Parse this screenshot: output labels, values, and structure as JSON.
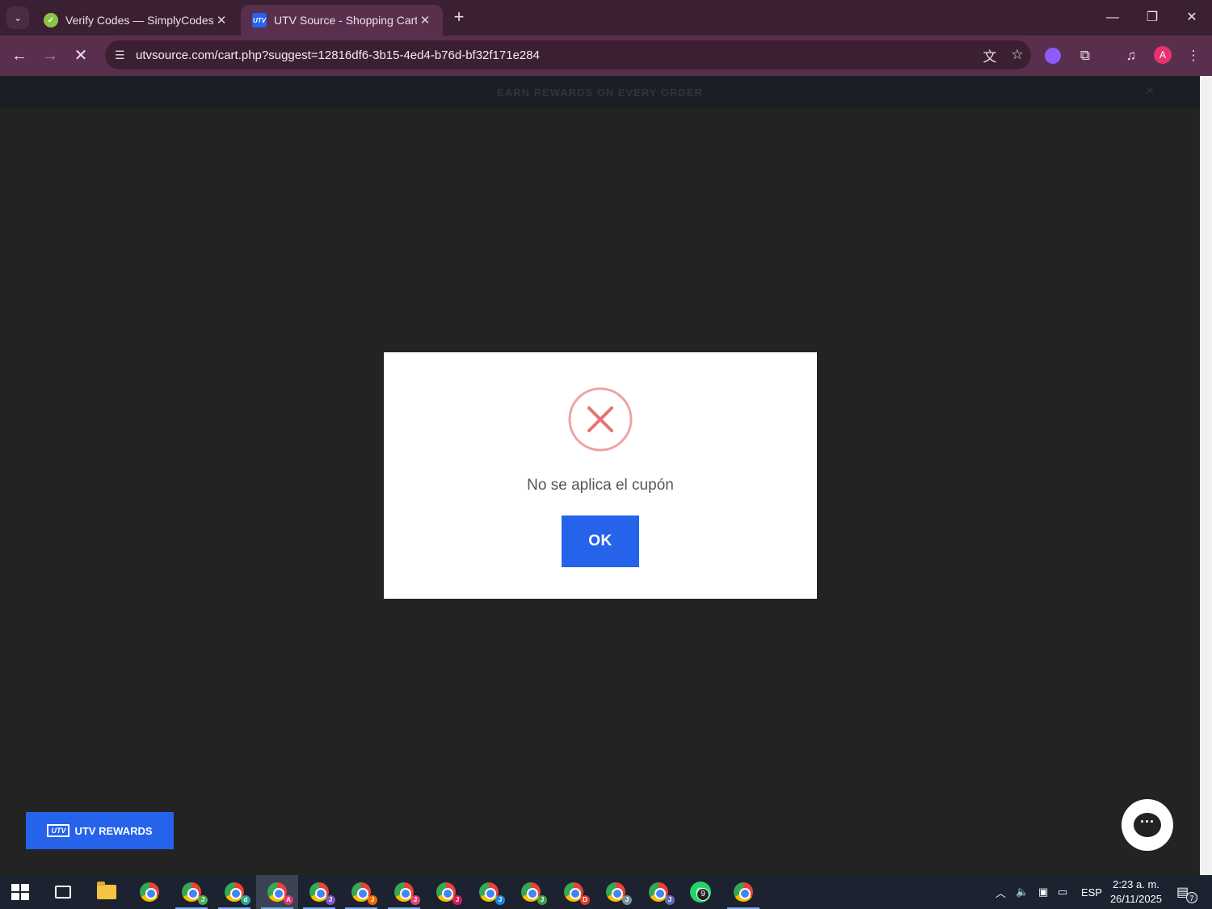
{
  "browser": {
    "tabs": [
      {
        "title": "Verify Codes — SimplyCodes",
        "active": false,
        "favicon": "simplycodes-favicon"
      },
      {
        "title": "UTV Source - Shopping Cart",
        "active": true,
        "favicon": "utv-favicon"
      }
    ],
    "url": "utvsource.com/cart.php?suggest=12816df6-3b15-4ed4-b76d-bf32f171e284",
    "profile_initial": "A"
  },
  "page": {
    "promo_text": "EARN REWARDS ON EVERY ORDER",
    "modal": {
      "message": "No se aplica el cupón",
      "ok_label": "OK",
      "icon": "error-x-icon",
      "icon_color": "#e57373"
    },
    "rewards_button": {
      "logo": "UTV",
      "label": "UTV REWARDS"
    },
    "accent_color": "#2563eb"
  },
  "taskbar": {
    "apps": [
      {
        "name": "chrome",
        "badge": ""
      },
      {
        "name": "chrome",
        "badge": "J"
      },
      {
        "name": "chrome",
        "badge": "d"
      },
      {
        "name": "chrome",
        "badge": "A"
      },
      {
        "name": "chrome",
        "badge": "J"
      },
      {
        "name": "chrome",
        "badge": "J"
      },
      {
        "name": "chrome",
        "badge": "J"
      },
      {
        "name": "chrome",
        "badge": "J"
      },
      {
        "name": "chrome",
        "badge": "J"
      },
      {
        "name": "chrome",
        "badge": "J"
      },
      {
        "name": "chrome",
        "badge": "D"
      },
      {
        "name": "chrome",
        "badge": "J"
      },
      {
        "name": "chrome",
        "badge": "J"
      }
    ],
    "whatsapp_badge": "9",
    "language": "ESP",
    "time": "2:23 a. m.",
    "date": "26/11/2025",
    "notifications": "7"
  }
}
